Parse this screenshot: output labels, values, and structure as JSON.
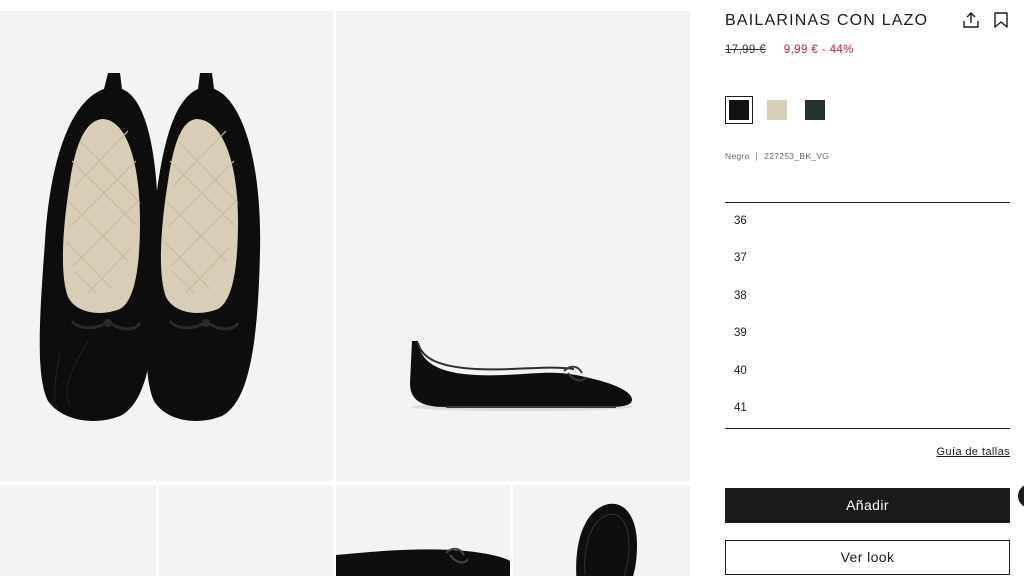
{
  "product": {
    "title": "BAILARINAS CON LAZO",
    "old_price": "17,99 €",
    "new_price": "9,99 € - 44%",
    "color_name": "Negro",
    "ref_separator": "|",
    "reference": "227253_BK_VG"
  },
  "swatches": [
    {
      "name": "Negro",
      "color": "#111111",
      "selected": true
    },
    {
      "name": "Beige",
      "color": "#d8cdb8",
      "selected": false
    },
    {
      "name": "Verde oscuro",
      "color": "#253330",
      "selected": false
    }
  ],
  "sizes": [
    "36",
    "37",
    "38",
    "39",
    "40",
    "41"
  ],
  "actions": {
    "size_guide": "Guía de tallas",
    "add": "Añadir",
    "view_look": "Ver look"
  },
  "icons": {
    "share": "share-icon",
    "save": "bookmark-icon",
    "chat": "chat-icon"
  },
  "colors": {
    "price_sale": "#c2185b",
    "primary": "#1a1a1a",
    "tile_bg": "#f3f3f3"
  }
}
